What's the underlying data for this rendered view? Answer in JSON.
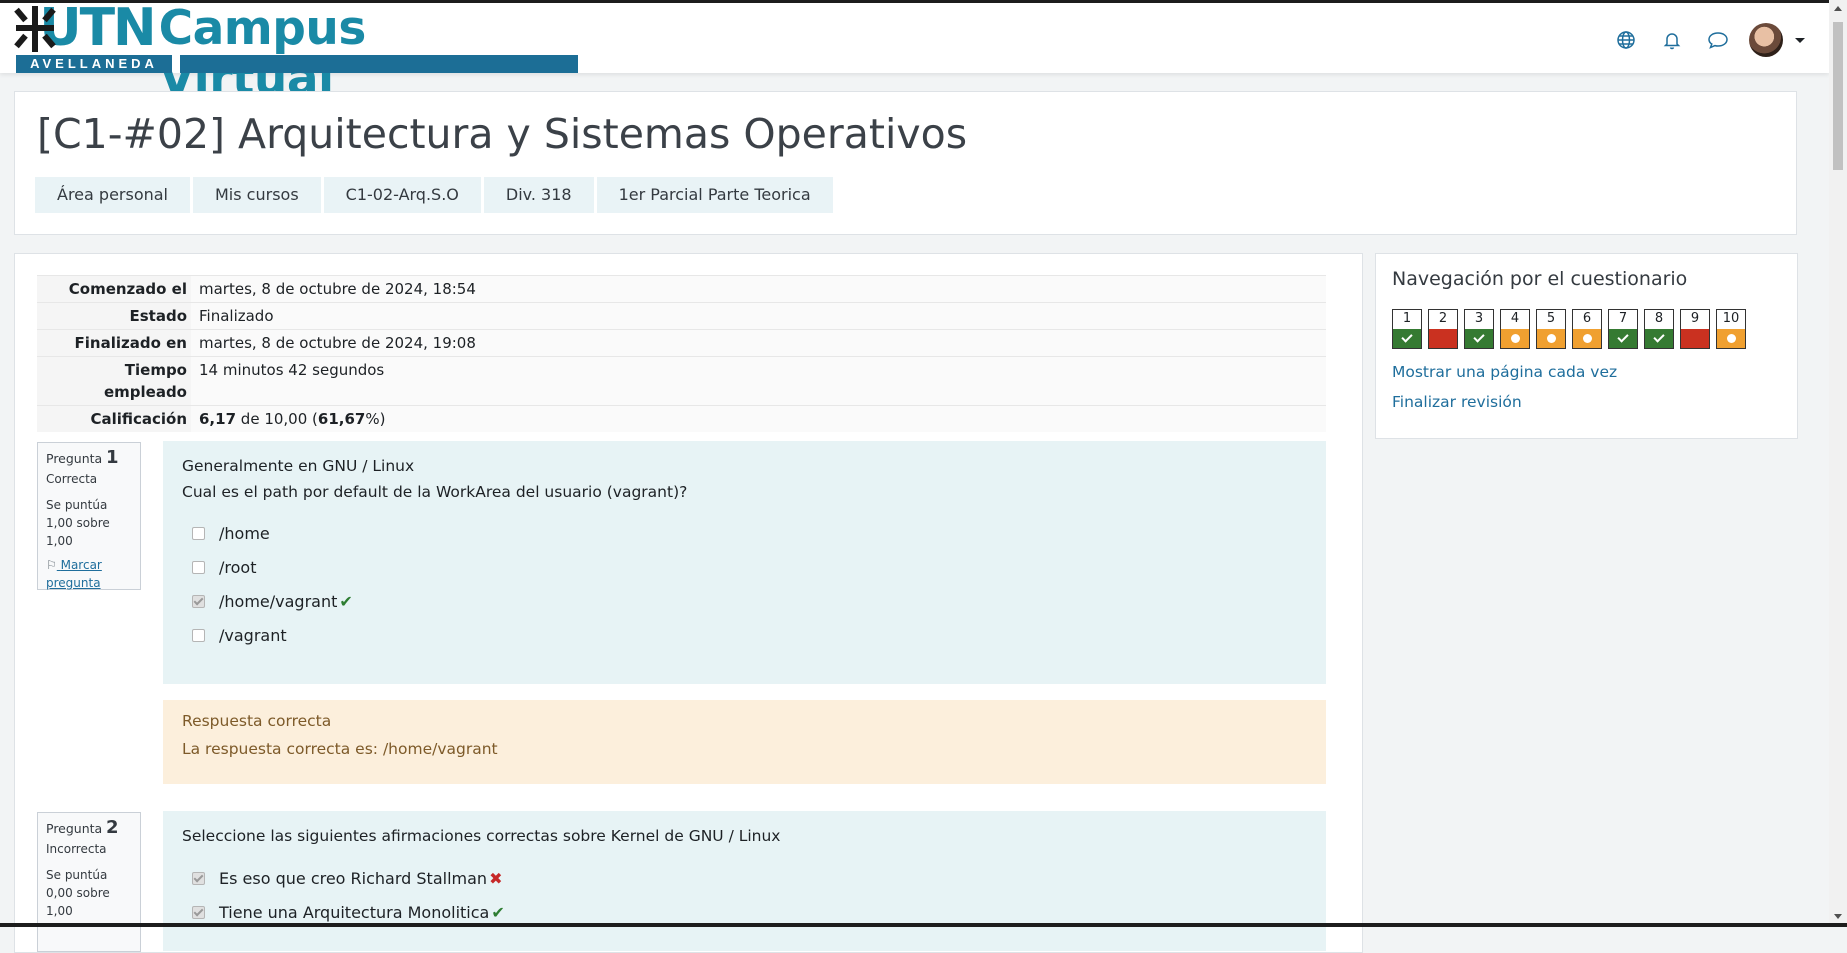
{
  "brand": {
    "logo_text": "UTN",
    "site_name": "Campus Virtual",
    "campus": "AVELLANEDA"
  },
  "navbar": {
    "icons": [
      "globe-icon",
      "bell-icon",
      "chat-icon"
    ]
  },
  "page": {
    "title": "[C1-#02] Arquitectura y Sistemas Operativos"
  },
  "breadcrumb": [
    "Área personal",
    "Mis cursos",
    "C1-02-Arq.S.O",
    "Div. 318",
    "1er Parcial Parte Teorica"
  ],
  "summary": {
    "started_label": "Comenzado el",
    "started_value": "martes, 8 de octubre de 2024, 18:54",
    "state_label": "Estado",
    "state_value": "Finalizado",
    "finished_label": "Finalizado en",
    "finished_value": "martes, 8 de octubre de 2024, 19:08",
    "time_label": "Tiempo empleado",
    "time_value": "14 minutos 42 segundos",
    "grade_label": "Calificación",
    "grade_score": "6,17",
    "grade_of": "de 10,00",
    "grade_percent": "61,67"
  },
  "questions": [
    {
      "label": "Pregunta",
      "number": "1",
      "state": "Correcta",
      "grade": "Se puntúa 1,00 sobre 1,00",
      "flag": "Marcar pregunta",
      "title": "Generalmente en GNU / Linux",
      "text": "Cual es el path por default de la WorkArea del usuario (vagrant)?",
      "answers": [
        "/home",
        "/root",
        "/home/vagrant",
        "/vagrant"
      ],
      "feedback_title": "Respuesta correcta",
      "feedback_text": "La respuesta correcta es: /home/vagrant"
    },
    {
      "label": "Pregunta",
      "number": "2",
      "state": "Incorrecta",
      "grade": "Se puntúa 0,00 sobre 1,00",
      "title": "Seleccione las siguientes afirmaciones correctas sobre Kernel de GNU / Linux",
      "answers": [
        "Es eso que creo Richard Stallman",
        "Tiene una Arquitectura Monolitica"
      ]
    }
  ],
  "quiz_nav": {
    "title": "Navegación por el cuestionario",
    "buttons": [
      {
        "n": "1",
        "state": "correct"
      },
      {
        "n": "2",
        "state": "wrong"
      },
      {
        "n": "3",
        "state": "correct"
      },
      {
        "n": "4",
        "state": "partial"
      },
      {
        "n": "5",
        "state": "partial"
      },
      {
        "n": "6",
        "state": "partial"
      },
      {
        "n": "7",
        "state": "correct"
      },
      {
        "n": "8",
        "state": "correct"
      },
      {
        "n": "9",
        "state": "wrong"
      },
      {
        "n": "10",
        "state": "partial"
      }
    ],
    "link_one_page": "Mostrar una página cada vez",
    "link_finish": "Finalizar revisión"
  },
  "colors": {
    "brand": "#1a8aa6",
    "brand_strip": "#1c6e96",
    "correct": "#357a32",
    "wrong": "#ca3120",
    "partial": "#f0a030",
    "link": "#1f6e9c"
  }
}
